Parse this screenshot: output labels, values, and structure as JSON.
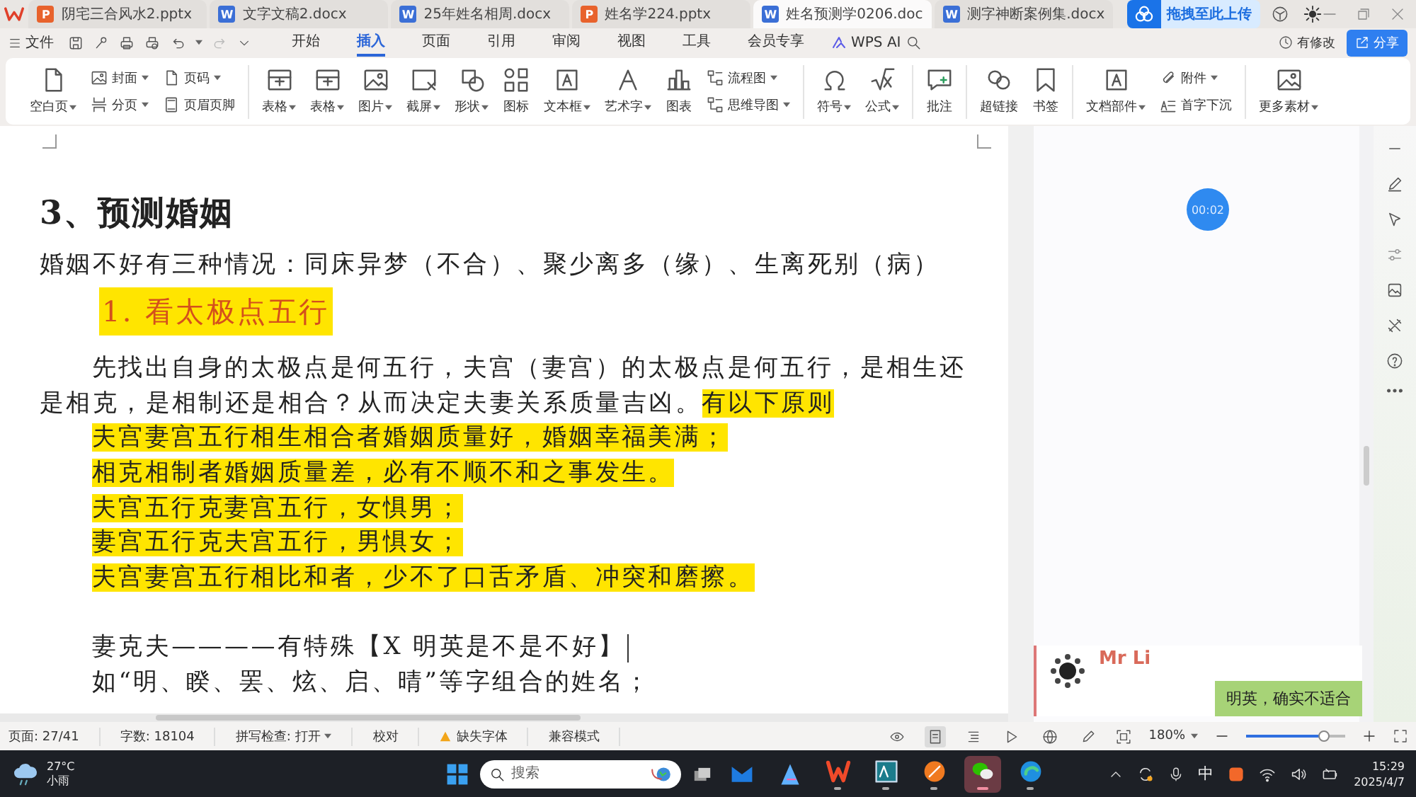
{
  "file_tabs": [
    {
      "badge": "P",
      "color": "#e8622c",
      "name": "阴宅三合风水2.pptx",
      "selected": false
    },
    {
      "badge": "W",
      "color": "#3b6fd6",
      "name": "文字文稿2.docx",
      "selected": false
    },
    {
      "badge": "W",
      "color": "#3b6fd6",
      "name": "25年姓名相周.docx",
      "selected": false
    },
    {
      "badge": "P",
      "color": "#e8622c",
      "name": "姓名学224.pptx",
      "selected": false
    },
    {
      "badge": "W",
      "color": "#3b6fd6",
      "name": "姓名预测学0206.doc",
      "selected": true
    },
    {
      "badge": "W",
      "color": "#3b6fd6",
      "name": "测字神断案例集.docx",
      "selected": false
    }
  ],
  "upload_button": "拖拽至此上传",
  "menu": {
    "file": "文件",
    "tabs": [
      {
        "label": "开始",
        "selected": false
      },
      {
        "label": "插入",
        "selected": true
      },
      {
        "label": "页面",
        "selected": false
      },
      {
        "label": "引用",
        "selected": false
      },
      {
        "label": "审阅",
        "selected": false
      },
      {
        "label": "视图",
        "selected": false
      },
      {
        "label": "工具",
        "selected": false
      },
      {
        "label": "会员专享",
        "selected": false
      }
    ],
    "ai": "WPS AI",
    "modified": "有修改",
    "share": "分享"
  },
  "ribbon": {
    "groups": [
      {
        "items": [
          {
            "kind": "large",
            "label": "空白页",
            "dropdown": true
          },
          {
            "kind": "stack",
            "items": [
              {
                "label": "封面",
                "dropdown": true
              },
              {
                "label": "分页",
                "dropdown": true
              }
            ]
          },
          {
            "kind": "stack",
            "items": [
              {
                "label": "页码",
                "dropdown": true
              },
              {
                "label": "页眉页脚",
                "dropdown": false
              }
            ]
          }
        ]
      },
      {
        "items": [
          {
            "kind": "large",
            "label": "表格",
            "dropdown": true
          },
          {
            "kind": "large",
            "label": "表格",
            "dropdown": true
          },
          {
            "kind": "large",
            "label": "图片",
            "dropdown": true
          },
          {
            "kind": "large",
            "label": "截屏",
            "dropdown": true
          },
          {
            "kind": "large",
            "label": "形状",
            "dropdown": true
          },
          {
            "kind": "large",
            "label": "图标",
            "dropdown": false
          },
          {
            "kind": "large",
            "label": "文本框",
            "dropdown": true
          },
          {
            "kind": "large",
            "label": "艺术字",
            "dropdown": true
          },
          {
            "kind": "large",
            "label": "图表",
            "dropdown": false
          },
          {
            "kind": "stack",
            "items": [
              {
                "label": "流程图",
                "dropdown": true
              },
              {
                "label": "思维导图",
                "dropdown": true
              }
            ]
          }
        ]
      },
      {
        "items": [
          {
            "kind": "large",
            "label": "符号",
            "dropdown": true
          },
          {
            "kind": "large",
            "label": "公式",
            "dropdown": true
          }
        ]
      },
      {
        "items": [
          {
            "kind": "large",
            "label": "批注",
            "dropdown": false
          }
        ]
      },
      {
        "items": [
          {
            "kind": "large",
            "label": "超链接",
            "dropdown": false
          },
          {
            "kind": "large",
            "label": "书签",
            "dropdown": false
          }
        ]
      },
      {
        "items": [
          {
            "kind": "large",
            "label": "文档部件",
            "dropdown": true
          },
          {
            "kind": "stack",
            "items": [
              {
                "label": "附件",
                "dropdown": true
              },
              {
                "label": "首字下沉",
                "dropdown": false
              }
            ]
          }
        ]
      },
      {
        "items": [
          {
            "kind": "large",
            "label": "更多素材",
            "dropdown": true
          }
        ]
      }
    ]
  },
  "document": {
    "blocks": [
      {
        "kind": "heading",
        "segments": [
          {
            "text": "3、预测婚姻",
            "highlighted": false
          }
        ]
      },
      {
        "kind": "para",
        "indent": false,
        "segments": [
          {
            "text": "婚姻不好有三种情况：同床异梦（不合）、聚少离多（缘）、生离死别（病）",
            "highlighted": false
          }
        ]
      },
      {
        "kind": "subheading",
        "segments": [
          {
            "text": "1. 看太极点五行",
            "highlighted": true
          }
        ]
      },
      {
        "kind": "para",
        "indent": true,
        "segments": [
          {
            "text": "先找出自身的太极点是何五行，夫宫（妻宫）的太极点是何五行，是相生还是相克，是相制还是相合？从而决定夫妻关系质量吉凶。",
            "highlighted": false
          },
          {
            "text": "有以下原则",
            "highlighted": true
          }
        ]
      },
      {
        "kind": "line",
        "segments": [
          {
            "text": "夫宫妻宫五行相生相合者婚姻质量好，婚姻幸福美满；",
            "highlighted": true
          }
        ]
      },
      {
        "kind": "line",
        "segments": [
          {
            "text": "相克相制者婚姻质量差，必有不顺不和之事发生。",
            "highlighted": true
          }
        ]
      },
      {
        "kind": "line",
        "segments": [
          {
            "text": "夫宫五行克妻宫五行，女惧男；",
            "highlighted": true
          }
        ]
      },
      {
        "kind": "line",
        "segments": [
          {
            "text": "妻宫五行克夫宫五行，男惧女；",
            "highlighted": true
          }
        ]
      },
      {
        "kind": "line",
        "segments": [
          {
            "text": "夫宫妻宫五行相比和者，少不了口舌矛盾、冲突和磨擦。",
            "highlighted": true
          }
        ]
      },
      {
        "kind": "blank"
      },
      {
        "kind": "line",
        "cursor": true,
        "segments": [
          {
            "text": "妻克夫————有特殊【X 明英是不是不好】",
            "highlighted": false
          }
        ]
      },
      {
        "kind": "line",
        "segments": [
          {
            "text": "如“明、睽、罢、炫、启、晴”等字组合的姓名；",
            "highlighted": false
          }
        ]
      }
    ]
  },
  "timer": "00:02",
  "chat": {
    "sender": "Mr Li",
    "message": "明英，确实不适合"
  },
  "status_bar": {
    "items": [
      {
        "text": "页面: 27/41"
      },
      {
        "text": "字数: 18104"
      },
      {
        "text": "拼写检查: 打开",
        "dropdown": true
      },
      {
        "text": "校对"
      },
      {
        "text": "缺失字体",
        "warning": true
      },
      {
        "text": "兼容模式"
      }
    ],
    "views": [
      {
        "kind": "read",
        "selected": false
      },
      {
        "kind": "page",
        "selected": true
      },
      {
        "kind": "outline",
        "selected": false
      },
      {
        "kind": "play",
        "selected": false
      },
      {
        "kind": "web",
        "selected": false
      },
      {
        "kind": "pen",
        "selected": false
      }
    ],
    "zoom": "180%",
    "zoom_slider": {
      "level": 0.78
    }
  },
  "taskbar": {
    "weather": {
      "temp": "27°C",
      "condition": "小雨"
    },
    "search": {
      "placeholder": "搜索"
    },
    "apps": [
      {
        "kind": "mail",
        "running": false,
        "selected": false
      },
      {
        "kind": "ai",
        "running": false,
        "selected": false
      },
      {
        "kind": "wps",
        "running": true,
        "selected": false
      },
      {
        "kind": "dict",
        "running": true,
        "selected": false
      },
      {
        "kind": "feather",
        "running": true,
        "selected": false
      },
      {
        "kind": "wechat",
        "running": true,
        "selected": true
      },
      {
        "kind": "edge",
        "running": true,
        "selected": false
      }
    ],
    "ime": "中",
    "time": "15:29",
    "date": "2025/4/7"
  }
}
